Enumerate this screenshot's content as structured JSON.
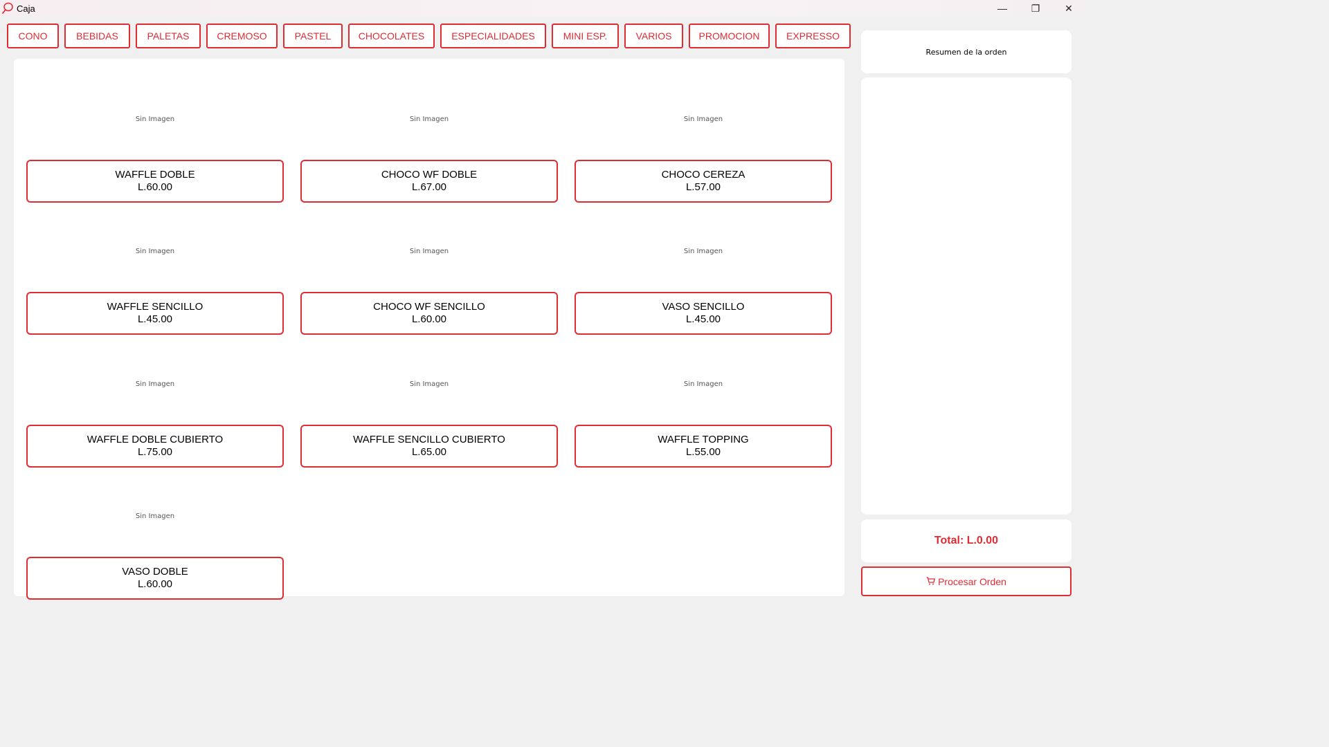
{
  "window": {
    "title": "Caja",
    "app_icon": "ice-cream-icon",
    "controls": {
      "minimize": "—",
      "restore": "❐",
      "close": "✕"
    }
  },
  "accent_color": "#e02b33",
  "categories": [
    "CONO",
    "BEBIDAS",
    "PALETAS",
    "CREMOSO",
    "PASTEL",
    "CHOCOLATES",
    "ESPECIALIDADES",
    "MINI ESP.",
    "VARIOS",
    "PROMOCION",
    "EXPRESSO"
  ],
  "products": [
    {
      "image_text": "Sin Imagen",
      "name": "WAFFLE DOBLE",
      "price": "L.60.00"
    },
    {
      "image_text": "Sin Imagen",
      "name": "CHOCO WF DOBLE",
      "price": "L.67.00"
    },
    {
      "image_text": "Sin Imagen",
      "name": "CHOCO CEREZA",
      "price": "L.57.00"
    },
    {
      "image_text": "Sin Imagen",
      "name": "WAFFLE SENCILLO",
      "price": "L.45.00"
    },
    {
      "image_text": "Sin Imagen",
      "name": "CHOCO WF SENCILLO",
      "price": "L.60.00"
    },
    {
      "image_text": "Sin Imagen",
      "name": "VASO SENCILLO",
      "price": "L.45.00"
    },
    {
      "image_text": "Sin Imagen",
      "name": "WAFFLE DOBLE CUBIERTO",
      "price": "L.75.00"
    },
    {
      "image_text": "Sin Imagen",
      "name": "WAFFLE SENCILLO CUBIERTO",
      "price": "L.65.00"
    },
    {
      "image_text": "Sin Imagen",
      "name": "WAFFLE TOPPING",
      "price": "L.55.00"
    },
    {
      "image_text": "Sin Imagen",
      "name": "VASO DOBLE",
      "price": "L.60.00"
    }
  ],
  "order": {
    "summary_title": "Resumen de la orden",
    "items": [],
    "total_label": "Total: L.0.00",
    "process_label": "Procesar Orden",
    "process_icon": "cart-icon"
  }
}
